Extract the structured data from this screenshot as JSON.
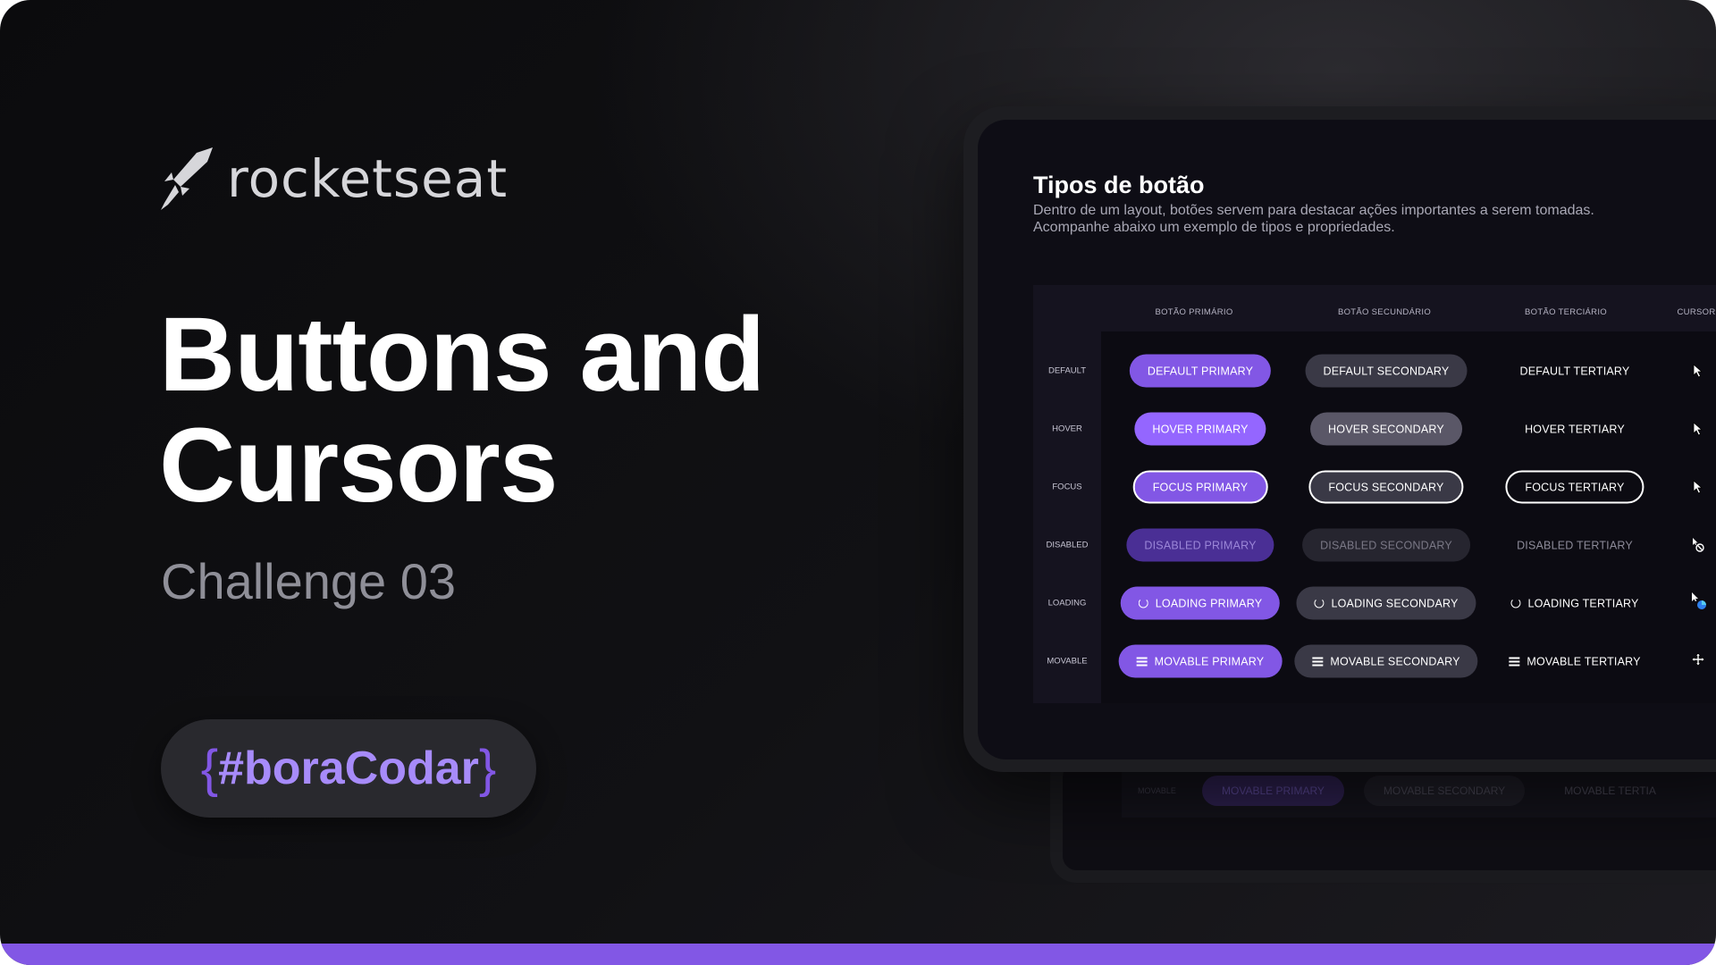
{
  "brand": {
    "name": "rocketseat"
  },
  "hero": {
    "title_line1": "Buttons and",
    "title_line2": "Cursors",
    "subtitle": "Challenge 03",
    "tag_open": "{",
    "tag_text": "#boraCodar",
    "tag_close": "}"
  },
  "colors": {
    "accent": "#8257e5",
    "background": "#121214",
    "tag_text": "#a78bfa"
  },
  "screen": {
    "title": "Tipos de botão",
    "description": "Dentro de um layout, botões servem para destacar ações importantes a serem tomadas. Acompanhe abaixo um exemplo de tipos e propriedades.",
    "columns": [
      "BOTÃO PRIMÁRIO",
      "BOTÃO SECUNDÁRIO",
      "BOTÃO TERCIÁRIO",
      "CURSOR"
    ],
    "rows": [
      {
        "label": "DEFAULT",
        "primary": "DEFAULT PRIMARY",
        "secondary": "DEFAULT SECONDARY",
        "tertiary": "DEFAULT TERTIARY",
        "cursor": "pointer-arrow-icon"
      },
      {
        "label": "HOVER",
        "primary": "HOVER PRIMARY",
        "secondary": "HOVER SECONDARY",
        "tertiary": "HOVER TERTIARY",
        "cursor": "pointer-arrow-icon"
      },
      {
        "label": "FOCUS",
        "primary": "FOCUS PRIMARY",
        "secondary": "FOCUS SECONDARY",
        "tertiary": "FOCUS TERTIARY",
        "cursor": "pointer-arrow-icon"
      },
      {
        "label": "DISABLED",
        "primary": "DISABLED PRIMARY",
        "secondary": "DISABLED SECONDARY",
        "tertiary": "DISABLED TERTIARY",
        "cursor": "not-allowed-icon"
      },
      {
        "label": "LOADING",
        "primary": "LOADING PRIMARY",
        "secondary": "LOADING SECONDARY",
        "tertiary": "LOADING TERTIARY",
        "cursor": "progress-cursor-icon"
      },
      {
        "label": "MOVABLE",
        "primary": "MOVABLE PRIMARY",
        "secondary": "MOVABLE SECONDARY",
        "tertiary": "MOVABLE TERTIARY",
        "cursor": "move-cursor-icon"
      }
    ]
  },
  "back_screen": {
    "label": "MOVABLE",
    "primary": "MOVABLE PRIMARY",
    "secondary": "MOVABLE SECONDARY",
    "tertiary": "MOVABLE TERTIA"
  }
}
